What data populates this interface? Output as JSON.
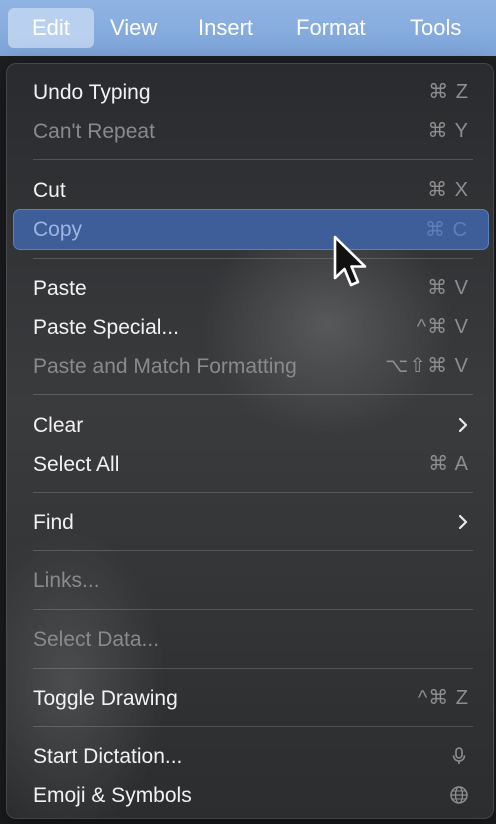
{
  "menubar": {
    "items": [
      "Edit",
      "View",
      "Insert",
      "Format",
      "Tools"
    ]
  },
  "menu": {
    "undo": {
      "label": "Undo Typing",
      "shortcut": "⌘ Z"
    },
    "repeat": {
      "label": "Can't Repeat",
      "shortcut": "⌘ Y"
    },
    "cut": {
      "label": "Cut",
      "shortcut": "⌘ X"
    },
    "copy": {
      "label": "Copy",
      "shortcut": "⌘ C"
    },
    "paste": {
      "label": "Paste",
      "shortcut": "⌘ V"
    },
    "paste_special": {
      "label": "Paste Special...",
      "shortcut": "^⌘ V"
    },
    "paste_match": {
      "label": "Paste and Match Formatting",
      "shortcut": "⌥⇧⌘ V"
    },
    "clear": {
      "label": "Clear"
    },
    "select_all": {
      "label": "Select All",
      "shortcut": "⌘ A"
    },
    "find": {
      "label": "Find"
    },
    "links": {
      "label": "Links..."
    },
    "select_data": {
      "label": "Select Data..."
    },
    "toggle_drawing": {
      "label": "Toggle Drawing",
      "shortcut": "^⌘ Z"
    },
    "start_dictation": {
      "label": "Start Dictation...",
      "icon": "microphone-icon"
    },
    "emoji_symbols": {
      "label": "Emoji & Symbols",
      "icon": "globe-icon"
    }
  },
  "colors": {
    "menubar": "#8fb3e2",
    "highlight": "#3d5e98",
    "text": "#f2f2f2",
    "disabled_text": "#8a8a8c"
  }
}
